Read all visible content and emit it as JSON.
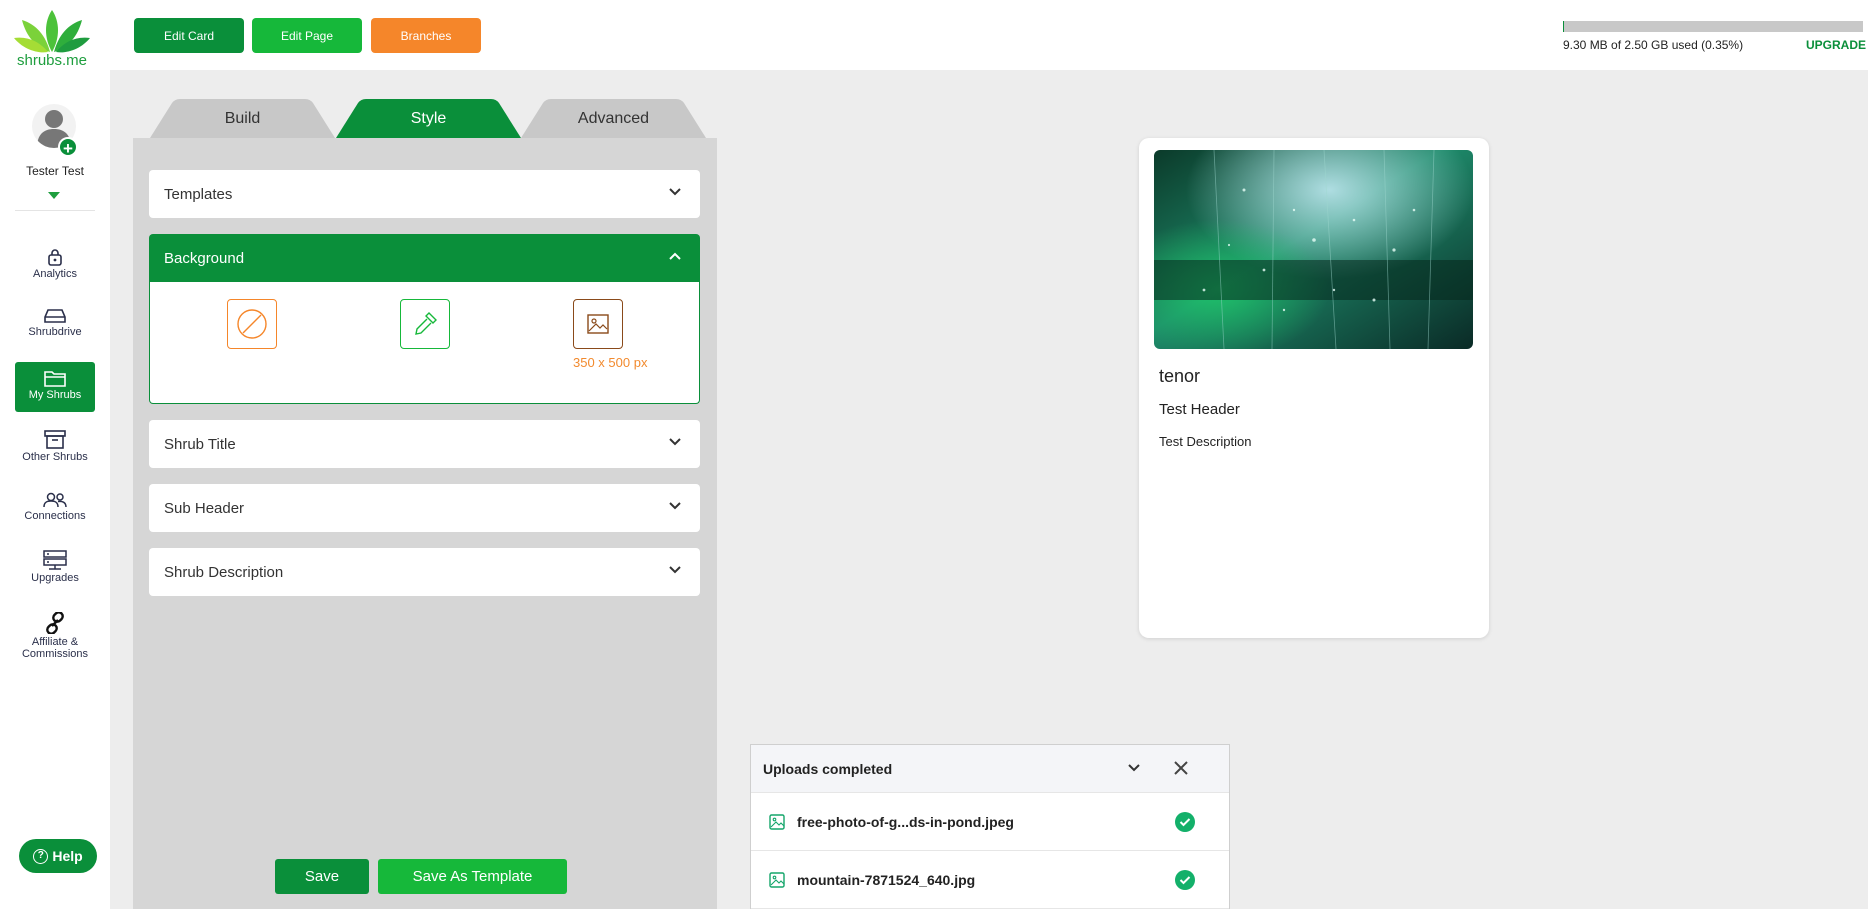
{
  "app": {
    "logo_text": "shrubs.me"
  },
  "user": {
    "name": "Tester Test"
  },
  "sidebar": {
    "items": [
      {
        "label": "Analytics",
        "icon": "lock-icon"
      },
      {
        "label": "Shrubdrive",
        "icon": "drive-icon"
      },
      {
        "label": "My Shrubs",
        "icon": "folder-icon",
        "active": true
      },
      {
        "label": "Other Shrubs",
        "icon": "archive-icon"
      },
      {
        "label": "Connections",
        "icon": "people-icon"
      },
      {
        "label": "Upgrades",
        "icon": "server-icon"
      },
      {
        "label": "Affiliate & Commissions",
        "icon": "link-icon"
      }
    ],
    "help_label": "Help"
  },
  "toolbar": {
    "edit_card": "Edit Card",
    "edit_page": "Edit Page",
    "branches": "Branches"
  },
  "storage": {
    "used_text": "9.30 MB of 2.50 GB used (0.35%)",
    "percent": 0.35,
    "upgrade_label": "UPGRADE"
  },
  "editor": {
    "tabs": [
      {
        "label": "Build",
        "active": false
      },
      {
        "label": "Style",
        "active": true
      },
      {
        "label": "Advanced",
        "active": false
      }
    ],
    "sections": {
      "templates": "Templates",
      "background": "Background",
      "shrub_title": "Shrub Title",
      "sub_header": "Sub Header",
      "shrub_description": "Shrub Description"
    },
    "background_size_hint": "350 x 500 px",
    "save_label": "Save",
    "save_template_label": "Save As Template"
  },
  "preview": {
    "title": "tenor",
    "sub_header": "Test Header",
    "description": "Test Description"
  },
  "uploads": {
    "title": "Uploads completed",
    "files": [
      {
        "name": "free-photo-of-g...ds-in-pond.jpeg",
        "status": "complete"
      },
      {
        "name": "mountain-7871524_640.jpg",
        "status": "complete"
      }
    ]
  },
  "colors": {
    "brand_green": "#0a8f3a",
    "button_green": "#16b83a",
    "orange": "#f5862a",
    "panel_gray": "#d6d6d6"
  }
}
